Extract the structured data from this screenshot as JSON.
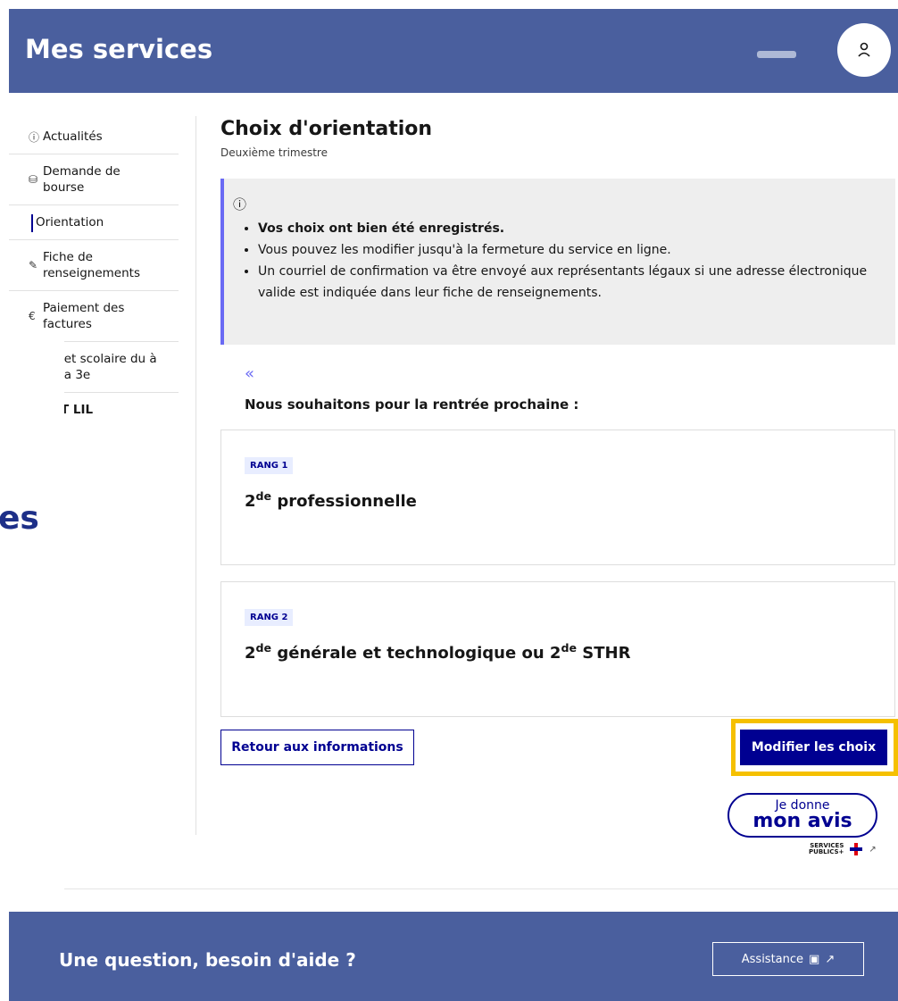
{
  "header": {
    "title": "Mes services"
  },
  "sidebar": {
    "items": [
      {
        "label": "Actualités",
        "icon": "info-icon"
      },
      {
        "label": "Demande de bourse",
        "icon": "coins-icon"
      },
      {
        "label": "Orientation",
        "active": true
      },
      {
        "label": "Fiche de renseignements",
        "icon": "edit-icon"
      },
      {
        "label": "Paiement des factures",
        "icon": "euro-icon"
      },
      {
        "label": "ıet scolaire du à la 3e"
      },
      {
        "label": "T LIL"
      }
    ]
  },
  "background_fragment": "es",
  "main": {
    "title": "Choix d'orientation",
    "subtitle": "Deuxième trimestre",
    "notice": {
      "items": [
        "Vos choix ont bien été enregistrés.",
        "Vous pouvez les modifier jusqu'à la fermeture du service en ligne.",
        "Un courriel de confirmation va être envoyé aux représentants légaux si une adresse électronique valide est indiquée dans leur fiche de renseignements."
      ]
    },
    "wish_label": "Nous souhaitons pour la rentrée prochaine :",
    "ranks": [
      {
        "badge": "RANG 1",
        "title_pre": "2",
        "title_sup": "de",
        "title_post": " professionnelle"
      },
      {
        "badge": "RANG 2",
        "title_pre": "2",
        "title_sup": "de",
        "title_mid": " générale et technologique ou 2",
        "title_sup2": "de",
        "title_post": " STHR"
      }
    ],
    "back_button": "Retour aux informations",
    "modify_button": "Modifier les choix",
    "avis": {
      "line1": "Je donne",
      "line2": "mon avis",
      "logo_text_1": "SERVICES",
      "logo_text_2": "PUBLICS+"
    }
  },
  "footer": {
    "title": "Une question, besoin d'aide ?",
    "assist_button": "Assistance"
  },
  "colors": {
    "header_bg": "#4a5f9e",
    "primary": "#000091",
    "highlight": "#f5c000",
    "notice_bg": "#eeeeee"
  }
}
